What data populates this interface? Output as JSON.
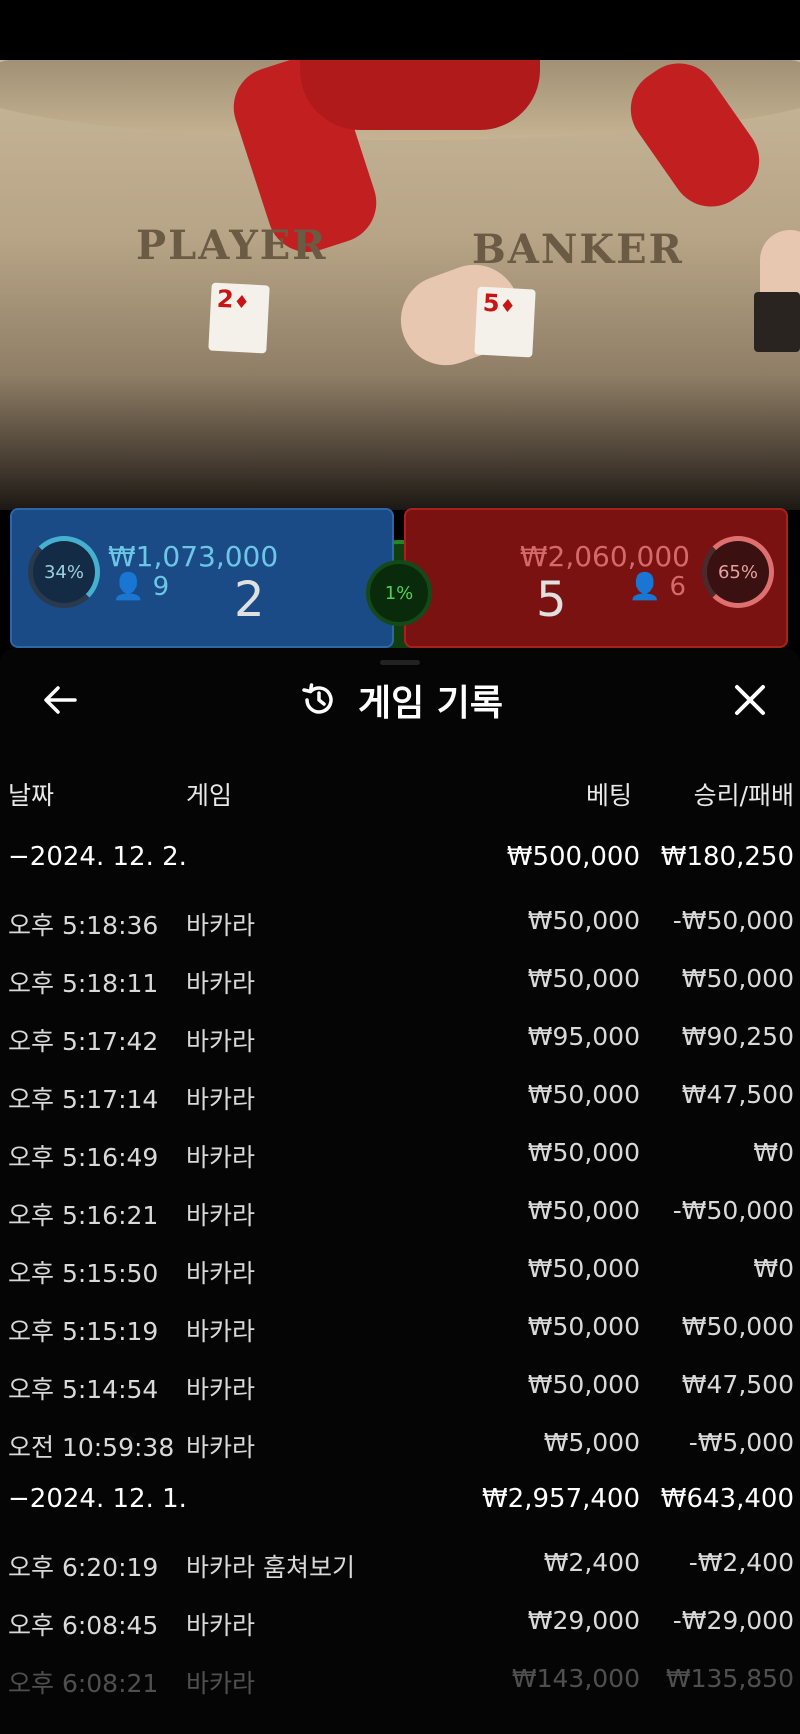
{
  "video": {
    "player_label": "PLAYER",
    "banker_label": "BANKER",
    "player_card": "2",
    "banker_card": "5",
    "card_suit": "♦"
  },
  "bets": {
    "player": {
      "percent": "34%",
      "amount": "₩1,073,000",
      "players": "9",
      "score": "2"
    },
    "tie": {
      "percent": "1%"
    },
    "banker": {
      "percent": "65%",
      "amount": "₩2,060,000",
      "players": "6",
      "score": "5"
    },
    "colors": {
      "player": "#1a4b86",
      "banker": "#7a1212",
      "tie": "#0f3e10"
    }
  },
  "header": {
    "title": "게임 기록",
    "icons": {
      "back": "arrow-left-icon",
      "history": "history-icon",
      "close": "close-icon"
    }
  },
  "columns": {
    "date": "날짜",
    "game": "게임",
    "bet": "베팅",
    "result": "승리/패배"
  },
  "groups": [
    {
      "date": "−2024. 12. 2.",
      "bet_total": "₩500,000",
      "result_total": "₩180,250",
      "rows": [
        {
          "time": "오후 5:18:36",
          "game": "바카라",
          "bet": "₩50,000",
          "result": "-₩50,000"
        },
        {
          "time": "오후 5:18:11",
          "game": "바카라",
          "bet": "₩50,000",
          "result": "₩50,000"
        },
        {
          "time": "오후 5:17:42",
          "game": "바카라",
          "bet": "₩95,000",
          "result": "₩90,250"
        },
        {
          "time": "오후 5:17:14",
          "game": "바카라",
          "bet": "₩50,000",
          "result": "₩47,500"
        },
        {
          "time": "오후 5:16:49",
          "game": "바카라",
          "bet": "₩50,000",
          "result": "₩0"
        },
        {
          "time": "오후 5:16:21",
          "game": "바카라",
          "bet": "₩50,000",
          "result": "-₩50,000"
        },
        {
          "time": "오후 5:15:50",
          "game": "바카라",
          "bet": "₩50,000",
          "result": "₩0"
        },
        {
          "time": "오후 5:15:19",
          "game": "바카라",
          "bet": "₩50,000",
          "result": "₩50,000"
        },
        {
          "time": "오후 5:14:54",
          "game": "바카라",
          "bet": "₩50,000",
          "result": "₩47,500"
        },
        {
          "time": "오전 10:59:38",
          "game": "바카라",
          "bet": "₩5,000",
          "result": "-₩5,000"
        }
      ]
    },
    {
      "date": "−2024. 12. 1.",
      "bet_total": "₩2,957,400",
      "result_total": "₩643,400",
      "rows": [
        {
          "time": "오후 6:20:19",
          "game": "바카라 훔쳐보기",
          "bet": "₩2,400",
          "result": "-₩2,400"
        },
        {
          "time": "오후 6:08:45",
          "game": "바카라",
          "bet": "₩29,000",
          "result": "-₩29,000"
        },
        {
          "time": "오후 6:08:21",
          "game": "바카라",
          "bet": "₩143,000",
          "result": "₩135,850"
        }
      ]
    }
  ]
}
